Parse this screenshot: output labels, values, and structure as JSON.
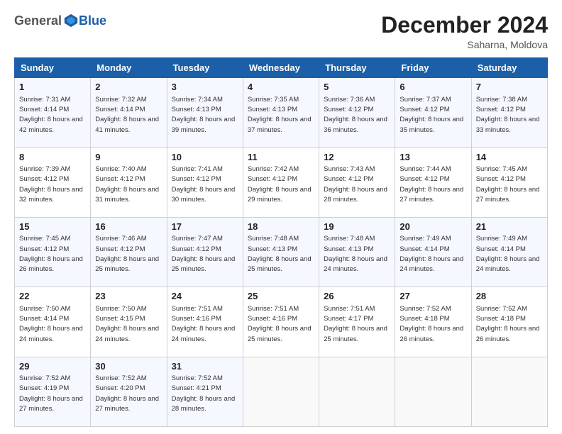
{
  "logo": {
    "general": "General",
    "blue": "Blue"
  },
  "header": {
    "month": "December 2024",
    "location": "Saharna, Moldova"
  },
  "weekdays": [
    "Sunday",
    "Monday",
    "Tuesday",
    "Wednesday",
    "Thursday",
    "Friday",
    "Saturday"
  ],
  "weeks": [
    [
      {
        "day": "1",
        "sunrise": "7:31 AM",
        "sunset": "4:14 PM",
        "daylight": "8 hours and 42 minutes."
      },
      {
        "day": "2",
        "sunrise": "7:32 AM",
        "sunset": "4:14 PM",
        "daylight": "8 hours and 41 minutes."
      },
      {
        "day": "3",
        "sunrise": "7:34 AM",
        "sunset": "4:13 PM",
        "daylight": "8 hours and 39 minutes."
      },
      {
        "day": "4",
        "sunrise": "7:35 AM",
        "sunset": "4:13 PM",
        "daylight": "8 hours and 37 minutes."
      },
      {
        "day": "5",
        "sunrise": "7:36 AM",
        "sunset": "4:12 PM",
        "daylight": "8 hours and 36 minutes."
      },
      {
        "day": "6",
        "sunrise": "7:37 AM",
        "sunset": "4:12 PM",
        "daylight": "8 hours and 35 minutes."
      },
      {
        "day": "7",
        "sunrise": "7:38 AM",
        "sunset": "4:12 PM",
        "daylight": "8 hours and 33 minutes."
      }
    ],
    [
      {
        "day": "8",
        "sunrise": "7:39 AM",
        "sunset": "4:12 PM",
        "daylight": "8 hours and 32 minutes."
      },
      {
        "day": "9",
        "sunrise": "7:40 AM",
        "sunset": "4:12 PM",
        "daylight": "8 hours and 31 minutes."
      },
      {
        "day": "10",
        "sunrise": "7:41 AM",
        "sunset": "4:12 PM",
        "daylight": "8 hours and 30 minutes."
      },
      {
        "day": "11",
        "sunrise": "7:42 AM",
        "sunset": "4:12 PM",
        "daylight": "8 hours and 29 minutes."
      },
      {
        "day": "12",
        "sunrise": "7:43 AM",
        "sunset": "4:12 PM",
        "daylight": "8 hours and 28 minutes."
      },
      {
        "day": "13",
        "sunrise": "7:44 AM",
        "sunset": "4:12 PM",
        "daylight": "8 hours and 27 minutes."
      },
      {
        "day": "14",
        "sunrise": "7:45 AM",
        "sunset": "4:12 PM",
        "daylight": "8 hours and 27 minutes."
      }
    ],
    [
      {
        "day": "15",
        "sunrise": "7:45 AM",
        "sunset": "4:12 PM",
        "daylight": "8 hours and 26 minutes."
      },
      {
        "day": "16",
        "sunrise": "7:46 AM",
        "sunset": "4:12 PM",
        "daylight": "8 hours and 25 minutes."
      },
      {
        "day": "17",
        "sunrise": "7:47 AM",
        "sunset": "4:12 PM",
        "daylight": "8 hours and 25 minutes."
      },
      {
        "day": "18",
        "sunrise": "7:48 AM",
        "sunset": "4:13 PM",
        "daylight": "8 hours and 25 minutes."
      },
      {
        "day": "19",
        "sunrise": "7:48 AM",
        "sunset": "4:13 PM",
        "daylight": "8 hours and 24 minutes."
      },
      {
        "day": "20",
        "sunrise": "7:49 AM",
        "sunset": "4:14 PM",
        "daylight": "8 hours and 24 minutes."
      },
      {
        "day": "21",
        "sunrise": "7:49 AM",
        "sunset": "4:14 PM",
        "daylight": "8 hours and 24 minutes."
      }
    ],
    [
      {
        "day": "22",
        "sunrise": "7:50 AM",
        "sunset": "4:14 PM",
        "daylight": "8 hours and 24 minutes."
      },
      {
        "day": "23",
        "sunrise": "7:50 AM",
        "sunset": "4:15 PM",
        "daylight": "8 hours and 24 minutes."
      },
      {
        "day": "24",
        "sunrise": "7:51 AM",
        "sunset": "4:16 PM",
        "daylight": "8 hours and 24 minutes."
      },
      {
        "day": "25",
        "sunrise": "7:51 AM",
        "sunset": "4:16 PM",
        "daylight": "8 hours and 25 minutes."
      },
      {
        "day": "26",
        "sunrise": "7:51 AM",
        "sunset": "4:17 PM",
        "daylight": "8 hours and 25 minutes."
      },
      {
        "day": "27",
        "sunrise": "7:52 AM",
        "sunset": "4:18 PM",
        "daylight": "8 hours and 26 minutes."
      },
      {
        "day": "28",
        "sunrise": "7:52 AM",
        "sunset": "4:18 PM",
        "daylight": "8 hours and 26 minutes."
      }
    ],
    [
      {
        "day": "29",
        "sunrise": "7:52 AM",
        "sunset": "4:19 PM",
        "daylight": "8 hours and 27 minutes."
      },
      {
        "day": "30",
        "sunrise": "7:52 AM",
        "sunset": "4:20 PM",
        "daylight": "8 hours and 27 minutes."
      },
      {
        "day": "31",
        "sunrise": "7:52 AM",
        "sunset": "4:21 PM",
        "daylight": "8 hours and 28 minutes."
      },
      null,
      null,
      null,
      null
    ]
  ]
}
